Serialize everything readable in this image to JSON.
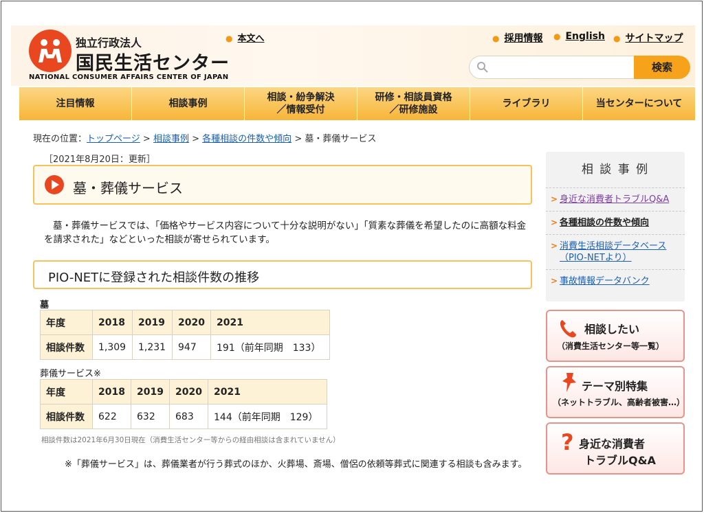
{
  "header": {
    "org_type": "独立行政法人",
    "org_name": "国民生活センター",
    "org_name_en": "NATIONAL CONSUMER AFFAIRS CENTER OF JAPAN",
    "skip_link": "本文へ",
    "links": [
      "採用情報",
      "English",
      "サイトマップ"
    ],
    "search_placeholder": "",
    "search_button": "検索"
  },
  "nav": {
    "items": [
      "注目情報",
      "相談事例",
      "相談・紛争解決\n／情報受付",
      "研修・相談員資格\n／研修施設",
      "ライブラリ",
      "当センターについて"
    ]
  },
  "breadcrumb": {
    "prefix": "現在の位置：",
    "items": [
      "トップページ",
      "相談事例",
      "各種相談の件数や傾向"
    ],
    "current": "墓・葬儀サービス",
    "sep": ">"
  },
  "main": {
    "updated": "［2021年8月20日：更新］",
    "title": "墓・葬儀サービス",
    "intro": "墓・葬儀サービスでは、「価格やサービス内容について十分な説明がない」「質素な葬儀を希望したのに高額な料金を請求された」などといった相談が寄せられています。",
    "section_title": "PIO-NETに登録された相談件数の推移",
    "table1": {
      "label": "墓",
      "header": [
        "年度",
        "2018",
        "2019",
        "2020",
        "2021"
      ],
      "row": [
        "相談件数",
        "1,309",
        "1,231",
        "947",
        "191（前年同期　133）"
      ]
    },
    "table2": {
      "label": "葬儀サービス※",
      "header": [
        "年度",
        "2018",
        "2019",
        "2020",
        "2021"
      ],
      "row": [
        "相談件数",
        "622",
        "632",
        "683",
        "144（前年同期　129）"
      ]
    },
    "small_note": "相談件数は2021年6月30日現在（消費生活センター等からの経由相談は含まれていません）",
    "note": "※「葬儀サービス」は、葬儀業者が行う葬式のほか、火葬場、斎場、僧侶の依頼等葬式に関連する相談も含みます。"
  },
  "sidebar": {
    "title": "相 談 事 例",
    "items": [
      "身近な消費者トラブルQ&A",
      "各種相談の件数や傾向",
      "消費生活相談データベース（PIO-NETより）",
      "事故情報データバンク"
    ],
    "buttons": [
      {
        "main": "相談したい",
        "sub": "（消費生活センター等一覧）"
      },
      {
        "main": "テーマ別特集",
        "sub": "（ネットトラブル、高齢者被害…）"
      },
      {
        "main": "身近な消費者",
        "main2": "トラブルQ&A"
      }
    ]
  },
  "colors": {
    "accent": "#f7a21b",
    "logo_red": "#e8471f",
    "link": "#1a5fb4"
  }
}
